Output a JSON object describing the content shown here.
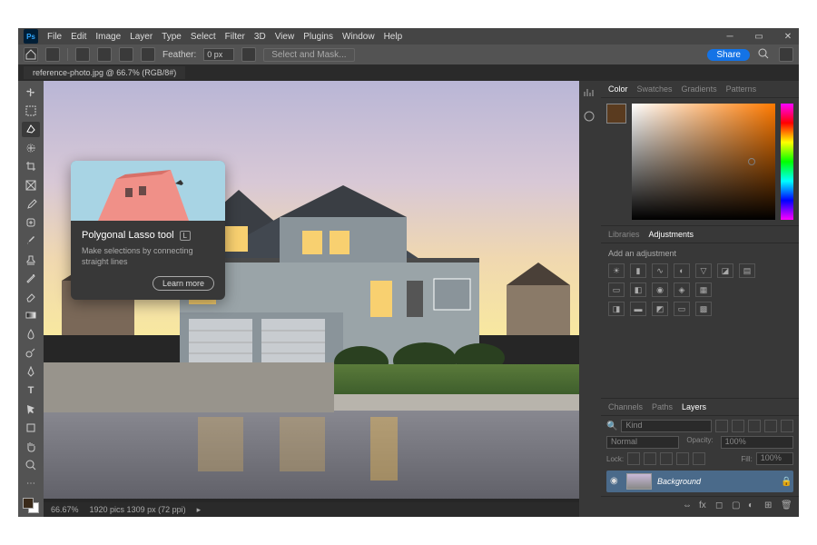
{
  "menubar": {
    "items": [
      "File",
      "Edit",
      "Image",
      "Layer",
      "Type",
      "Select",
      "Filter",
      "3D",
      "View",
      "Plugins",
      "Window",
      "Help"
    ]
  },
  "optbar": {
    "feather_label": "Feather:",
    "feather_value": "0 px",
    "select_mask": "Select and Mask...",
    "share": "Share"
  },
  "doc_tab": "reference-photo.jpg @ 66.7% (RGB/8#)",
  "tooltip": {
    "title": "Polygonal Lasso tool",
    "shortcut": "L",
    "desc": "Make selections by connecting straight lines",
    "learn": "Learn more"
  },
  "color_tabs": [
    "Color",
    "Swatches",
    "Gradients",
    "Patterns"
  ],
  "mid_tabs": [
    "Libraries",
    "Adjustments"
  ],
  "adjustments": {
    "label": "Add an adjustment"
  },
  "props_tabs": [
    "Channels",
    "Paths",
    "Layers"
  ],
  "layers": {
    "kind": "Kind",
    "blend": "Normal",
    "opacity_label": "Opacity:",
    "opacity_value": "100%",
    "lock_label": "Lock:",
    "fill_label": "Fill:",
    "fill_value": "100%",
    "layer0_name": "Background"
  },
  "statusbar": {
    "zoom": "66.67%",
    "dims": "1920 pics 1309 px (72 ppi)"
  },
  "colors": {
    "accent": "#1473e6",
    "fg_swatch": "#5a3b1f"
  }
}
